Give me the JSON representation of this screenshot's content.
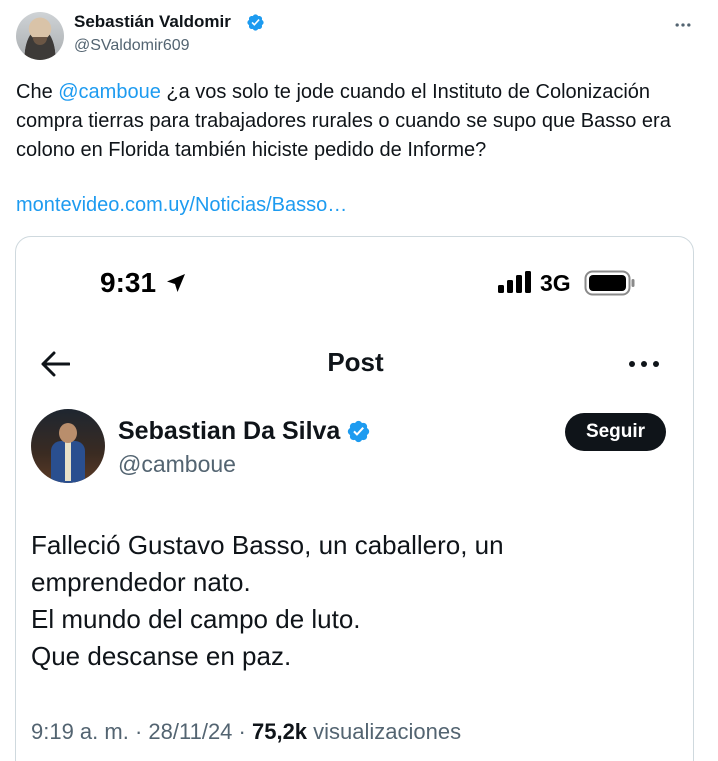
{
  "tweet": {
    "author": {
      "name": "Sebastián Valdomir",
      "handle": "@SValdomir609",
      "verified": true
    },
    "text": {
      "prefix": "Che ",
      "mention": "@camboue",
      "suffix": " ¿a vos solo te jode cuando el Instituto de Colonización compra tierras para trabajadores rurales o cuando se supo que Basso era colono en Florida también hiciste pedido de Informe?"
    },
    "link": "montevideo.com.uy/Noticias/Basso…",
    "more_icon": "more-horizontal-icon"
  },
  "embedded_screenshot": {
    "status_bar": {
      "time": "9:31",
      "network": "3G",
      "icons": [
        "location-arrow-icon",
        "signal-icon",
        "battery-icon"
      ]
    },
    "header": {
      "title": "Post",
      "icons": [
        "back-arrow-icon",
        "more-horizontal-icon"
      ]
    },
    "author": {
      "name": "Sebastian Da Silva",
      "handle": "@camboue",
      "verified": true,
      "follow_label": "Seguir"
    },
    "lines": [
      "Falleció Gustavo Basso, un caballero, un",
      "emprendedor nato.",
      "El mundo del campo de luto.",
      "Que descanse en paz."
    ],
    "meta": {
      "time": "9:19 a. m.",
      "separator": " · ",
      "date": "28/11/24",
      "views_count": "75,2k",
      "views_label": "visualizaciones"
    }
  },
  "colors": {
    "link_blue": "#1d9bf0",
    "verified_blue": "#1d9bf0",
    "text_primary": "#0f1419",
    "text_secondary": "#536471",
    "border": "#cfd9de"
  }
}
